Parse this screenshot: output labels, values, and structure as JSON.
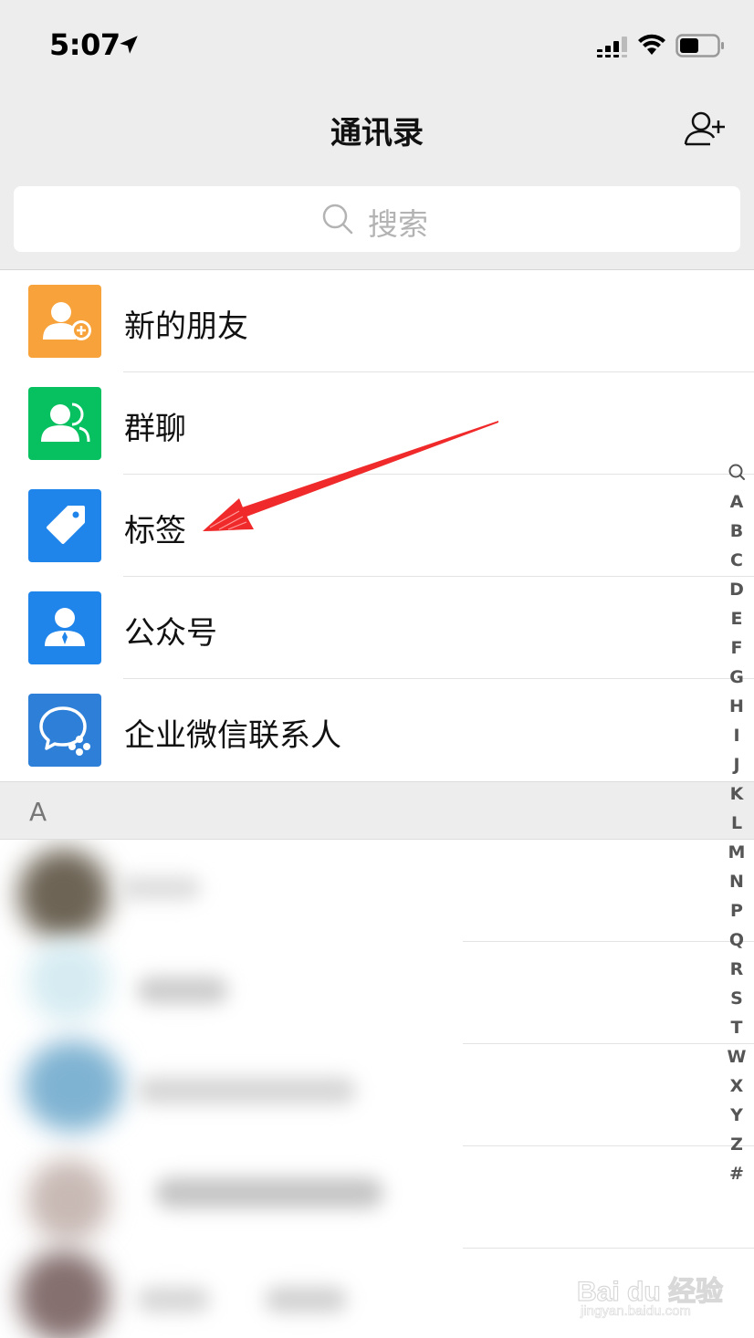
{
  "status_bar": {
    "time": "5:07",
    "icons": [
      "location-arrow-icon",
      "cellular-signal-icon",
      "wifi-icon",
      "battery-icon"
    ]
  },
  "header": {
    "title": "通讯录",
    "add_icon": "add-contact-icon"
  },
  "search": {
    "placeholder": "搜索"
  },
  "menu": [
    {
      "label": "新的朋友",
      "icon": "new-friend-icon",
      "color": "#f7a23b"
    },
    {
      "label": "群聊",
      "icon": "group-chat-icon",
      "color": "#07c160"
    },
    {
      "label": "标签",
      "icon": "tag-icon",
      "color": "#1f85ea"
    },
    {
      "label": "公众号",
      "icon": "official-account-icon",
      "color": "#1f85ea"
    },
    {
      "label": "企业微信联系人",
      "icon": "wecom-contacts-icon",
      "color": "#2d7fd8"
    }
  ],
  "section": {
    "letter": "A"
  },
  "index_letters": [
    "A",
    "B",
    "C",
    "D",
    "E",
    "F",
    "G",
    "H",
    "I",
    "J",
    "K",
    "L",
    "M",
    "N",
    "P",
    "Q",
    "R",
    "S",
    "T",
    "W",
    "X",
    "Y",
    "Z",
    "#"
  ],
  "annotation": {
    "color": "#f02a2a",
    "points_to": "标签"
  },
  "watermark": {
    "main": "Bai du 经验",
    "sub": "jingyan.baidu.com"
  }
}
